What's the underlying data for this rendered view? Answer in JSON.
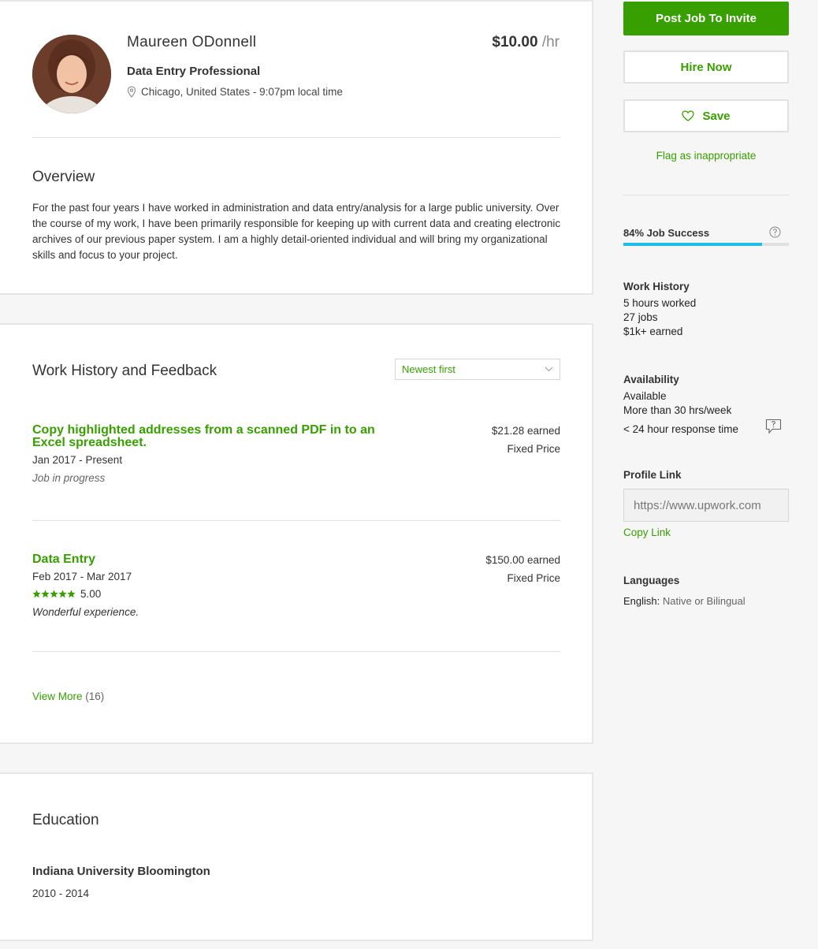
{
  "profile": {
    "name": "Maureen ODonnell",
    "title": "Data Entry Professional",
    "location": "Chicago, United States - 9:07pm local time",
    "rate": "$10.00",
    "rate_unit": "/hr"
  },
  "overview": {
    "heading": "Overview",
    "text": "For the past four years I have worked in administration and data entry/analysis for a large public university. Over the course of my work, I have been primarily responsible for keeping up with current data and creating electronic archives of our previous paper system. I am a highly detail-oriented individual and will bring my organizational skills and focus to your project."
  },
  "work_history": {
    "heading": "Work History and Feedback",
    "sort_selected": "Newest first",
    "jobs": [
      {
        "title": "Copy highlighted addresses from a scanned PDF in to an Excel spreadsheet.",
        "dates": "Jan 2017 - Present",
        "status": "Job in progress",
        "earned": "$21.28 earned",
        "type": "Fixed Price"
      },
      {
        "title": "Data Entry",
        "dates": "Feb 2017 - Mar 2017",
        "rating": 5,
        "rating_text": "5.00",
        "feedback": "Wonderful experience.",
        "earned": "$150.00 earned",
        "type": "Fixed Price"
      }
    ],
    "view_more_label": "View More",
    "view_more_count": "(16)"
  },
  "education": {
    "heading": "Education",
    "school": "Indiana University Bloomington",
    "years": "2010 - 2014"
  },
  "sidebar": {
    "post_job_label": "Post Job To Invite",
    "hire_now_label": "Hire Now",
    "save_label": "Save",
    "flag_label": "Flag as inappropriate",
    "job_success_label": "84% Job Success",
    "job_success_value": 0.84,
    "work_history_heading": "Work History",
    "hours_worked": "5 hours worked",
    "jobs_count": "27 jobs",
    "earned": "$1k+ earned",
    "availability_heading": "Availability",
    "availability_status": "Available",
    "availability_hours": "More than 30 hrs/week",
    "response_time": "< 24 hour response time",
    "profile_link_heading": "Profile Link",
    "profile_link_value": "https://www.upwork.com",
    "copy_link_label": "Copy Link",
    "languages_heading": "Languages",
    "language_name": "English:",
    "language_level": "Native or Bilingual"
  },
  "colors": {
    "brand_green": "#37a000",
    "progress_blue": "#1fbde8"
  }
}
